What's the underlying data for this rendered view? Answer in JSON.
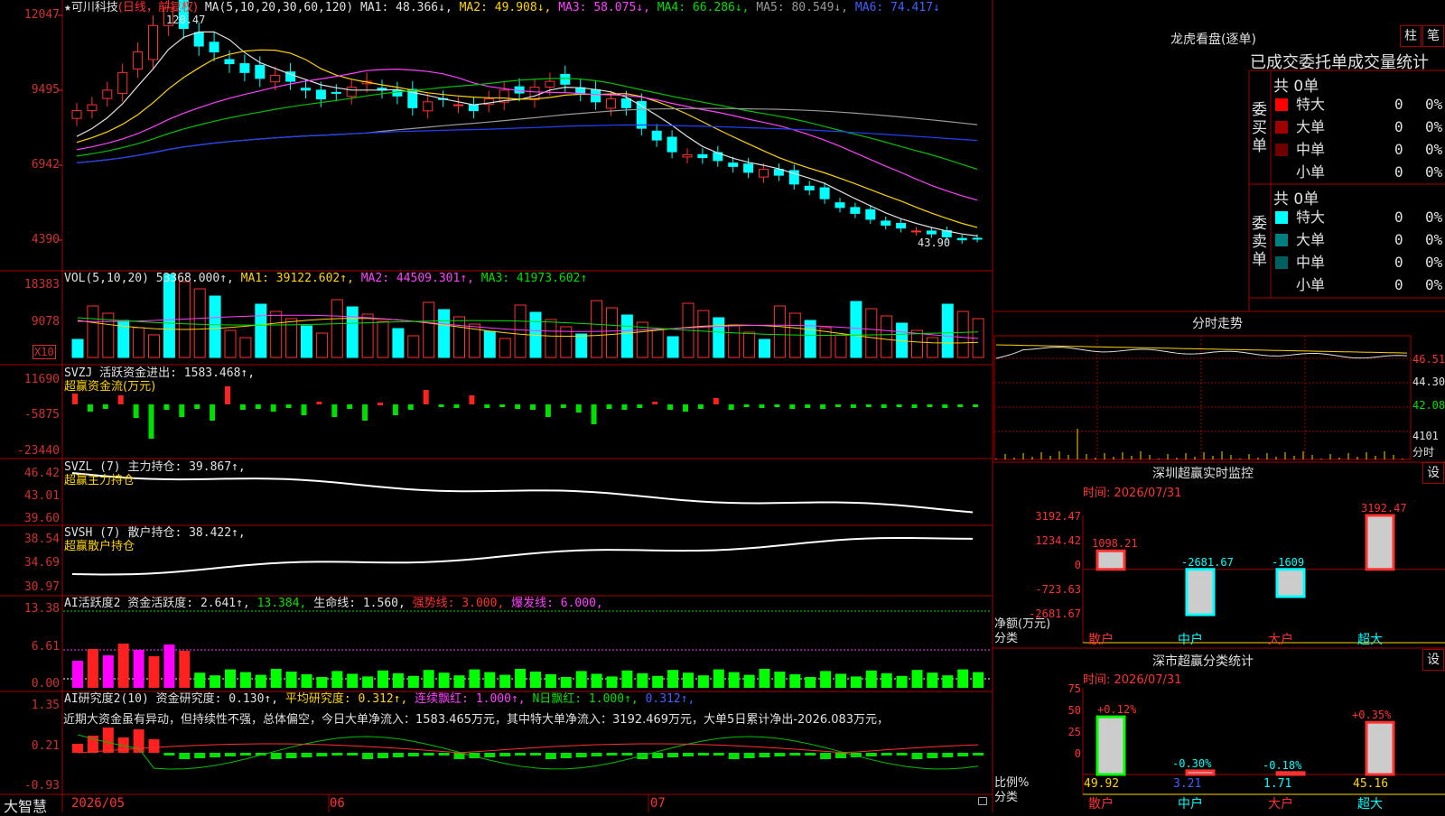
{
  "main_chart": {
    "star": "★",
    "stock_name": "可川科技",
    "period": "(日线，前复权)",
    "ma_params": "MA(5,10,20,30,60,120)",
    "ma1": "MA1: 48.366↓,",
    "ma2": "MA2: 49.908↓,",
    "ma3": "MA3: 58.075↓,",
    "ma4": "MA4: 66.286↓,",
    "ma5": "MA5: 80.549↓,",
    "ma6": "MA6: 74.417↓",
    "y_labels": [
      "12047",
      "9495",
      "6942",
      "4390"
    ],
    "high_label": "120.47",
    "low_label": "43.90"
  },
  "vol_chart": {
    "header": "VOL(5,10,20)",
    "value": "53368.000↑,",
    "ma1": "MA1: 39122.602↑,",
    "ma2": "MA2: 44509.301↑,",
    "ma3": "MA3: 41973.602↑",
    "y_labels": [
      "18383",
      "9078"
    ],
    "unit": "X10"
  },
  "svzj": {
    "header": "SVZJ  活跃资金进出: 1583.468↑,",
    "sub": "超赢资金流(万元)",
    "y_labels": [
      "11690",
      "-5875",
      "-23440"
    ]
  },
  "svzl": {
    "header": "SVZL (7) 主力持仓: 39.867↑,",
    "sub": "超赢主力持仓",
    "y_labels": [
      "46.42",
      "43.01",
      "39.60"
    ]
  },
  "svsh": {
    "header": "SVSH (7) 散户持仓: 38.422↑,",
    "sub": "超赢散户持仓",
    "y_labels": [
      "38.54",
      "34.69",
      "30.97"
    ]
  },
  "ai_activity": {
    "p1": "AI活跃度2 资金活跃度: 2.641↑,",
    "p2": "13.384,",
    "p3": "生命线: 1.560,",
    "p4": "强势线: 3.000,",
    "p5": "爆发线: 6.000,",
    "y_labels": [
      "13.38",
      "6.61",
      "0.00"
    ]
  },
  "ai_research": {
    "p1": "AI研究度2(10) 资金研究度: 0.130↑,",
    "p2": "平均研究度: 0.312↑,",
    "p3": "连续飘红: 1.000↑,",
    "p4": "N日飘红: 1.000↑,",
    "p5": "0.312↑,",
    "comment": "近期大资金虽有异动，但持续性不强，总体偏空，今日大单净流入：1583.465万元，其中特大单净流入：3192.469万元，大单5日累计净出-2026.083万元，",
    "y_labels": [
      "1.35",
      "0.21",
      "-0.93"
    ]
  },
  "bottom_axis": {
    "brand": "大智慧",
    "dates": [
      "2026/05",
      "06",
      "07"
    ]
  },
  "dragon_tiger": {
    "title": "龙虎看盘(逐单)",
    "btn_bar": "柱",
    "btn_pen": "笔",
    "stats_title": "已成交委托单成交量统计",
    "buy_label": "委买单",
    "sell_label": "委卖单",
    "buy_total": "共 0单",
    "sell_total": "共 0单",
    "rows": [
      {
        "name": "特大",
        "count": "0",
        "pct": "0%"
      },
      {
        "name": "大单",
        "count": "0",
        "pct": "0%"
      },
      {
        "name": "中单",
        "count": "0",
        "pct": "0%"
      },
      {
        "name": "小单",
        "count": "0",
        "pct": "0%"
      }
    ],
    "colors": {
      "buy": [
        "#ff0000",
        "#a00000",
        "#700000",
        "#000000"
      ],
      "sell": [
        "#00ffff",
        "#008080",
        "#006060",
        "#000000"
      ]
    }
  },
  "intraday": {
    "title": "分时走势",
    "y_labels": [
      "46.51",
      "44.30",
      "42.08",
      "4101",
      "分时"
    ]
  },
  "sz_monitor": {
    "title": "深圳超赢实时监控",
    "btn": "设",
    "time": "时间: 2026/07/31",
    "y_labels": [
      "3192.47",
      "1234.42",
      "0",
      "-723.63",
      "-2681.67"
    ],
    "y_title": "净额(万元)",
    "x_title": "分类",
    "values": [
      1098.21,
      -2681.67,
      -1609,
      3192.47
    ],
    "value_labels": [
      "1098.21",
      "-2681.67",
      "-1609",
      "3192.47"
    ],
    "categories": [
      "散户",
      "中户",
      "大户",
      "超大"
    ]
  },
  "sz_classify": {
    "title": "深市超赢分类统计",
    "btn": "设",
    "time": "时间: 2026/07/31",
    "y_labels": [
      "75",
      "50",
      "25",
      "0"
    ],
    "y_title": "比例%",
    "x_title": "分类",
    "base": [
      49.92,
      3.21,
      1.71,
      45.16
    ],
    "base_labels": [
      "49.92",
      "3.21",
      "1.71",
      "45.16"
    ],
    "deltas": [
      "+0.12%",
      "-0.30%",
      "-0.18%",
      "+0.35%"
    ],
    "categories": [
      "散户",
      "中户",
      "大户",
      "超大"
    ]
  }
}
